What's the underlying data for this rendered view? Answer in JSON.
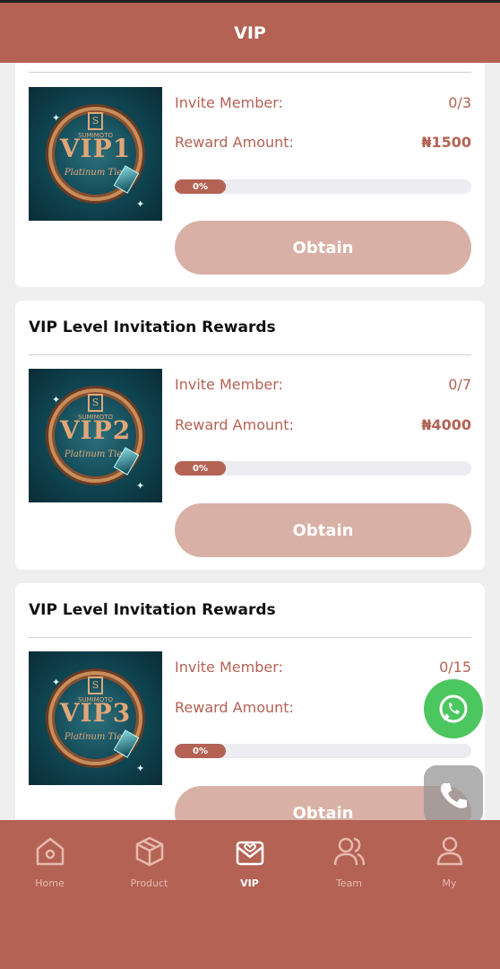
{
  "header": {
    "title": "VIP"
  },
  "cards": [
    {
      "title": "",
      "vip_label": "VIP1",
      "brand": "SUMIMOTO",
      "badge": "S",
      "subtitle": "Platinum Tier",
      "invite_label": "Invite Member:",
      "invite_value": "0/3",
      "reward_label": "Reward Amount:",
      "reward_value": "₦1500",
      "progress_label": "0%",
      "progress": 0,
      "button_label": "Obtain"
    },
    {
      "title": "VIP Level Invitation Rewards",
      "vip_label": "VIP2",
      "brand": "SUMIMOTO",
      "badge": "S",
      "subtitle": "Platinum Tier",
      "invite_label": "Invite Member:",
      "invite_value": "0/7",
      "reward_label": "Reward Amount:",
      "reward_value": "₦4000",
      "progress_label": "0%",
      "progress": 0,
      "button_label": "Obtain"
    },
    {
      "title": "VIP Level Invitation Rewards",
      "vip_label": "VIP3",
      "brand": "SUMIMOTO",
      "badge": "S",
      "subtitle": "Platinum Tier",
      "invite_label": "Invite Member:",
      "invite_value": "0/15",
      "reward_label": "Reward Amount:",
      "reward_value": "₦",
      "progress_label": "0%",
      "progress": 0,
      "button_label": "Obtain"
    }
  ],
  "nav": {
    "items": [
      {
        "label": "Home",
        "icon": "home-icon"
      },
      {
        "label": "Product",
        "icon": "box-icon"
      },
      {
        "label": "VIP",
        "icon": "vip-heart-icon",
        "active": true
      },
      {
        "label": "Team",
        "icon": "team-icon"
      },
      {
        "label": "My",
        "icon": "user-icon"
      }
    ]
  },
  "floating": {
    "whatsapp_icon": "whatsapp-icon",
    "phone_icon": "phone-icon"
  },
  "colors": {
    "brand": "#b46254",
    "button_disabled": "#d9b0a6",
    "whatsapp": "#4cc75f"
  }
}
